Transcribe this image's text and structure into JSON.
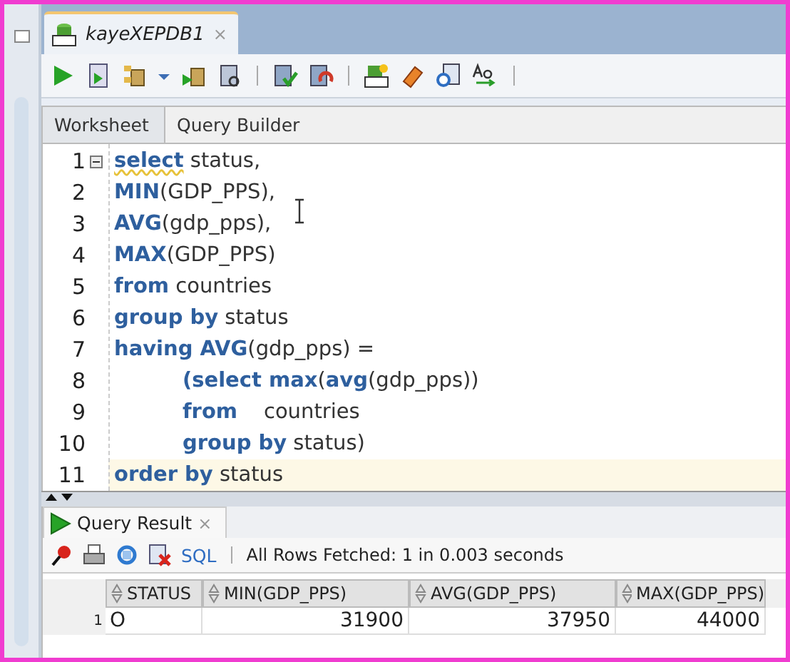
{
  "document_tab": {
    "title": "kayeXEPDB1",
    "close": "×"
  },
  "editor_tabs": [
    {
      "label": "Worksheet",
      "selected": true
    },
    {
      "label": "Query Builder",
      "selected": false
    }
  ],
  "code_lines": [
    {
      "number": "1",
      "current": false,
      "indented": false,
      "tokens": [
        {
          "text": "select",
          "kind": "flagged"
        },
        {
          "text": " status,",
          "kind": "plain"
        }
      ]
    },
    {
      "number": "2",
      "current": false,
      "indented": false,
      "tokens": [
        {
          "text": "MIN",
          "kind": "keyword"
        },
        {
          "text": "(GDP_PPS),",
          "kind": "plain"
        }
      ]
    },
    {
      "number": "3",
      "current": false,
      "indented": false,
      "tokens": [
        {
          "text": "AVG",
          "kind": "keyword"
        },
        {
          "text": "(gdp_pps),",
          "kind": "plain"
        }
      ]
    },
    {
      "number": "4",
      "current": false,
      "indented": false,
      "tokens": [
        {
          "text": "MAX",
          "kind": "keyword"
        },
        {
          "text": "(GDP_PPS)",
          "kind": "plain"
        }
      ]
    },
    {
      "number": "5",
      "current": false,
      "indented": false,
      "tokens": [
        {
          "text": "from",
          "kind": "keyword"
        },
        {
          "text": " countries",
          "kind": "plain"
        }
      ]
    },
    {
      "number": "6",
      "current": false,
      "indented": false,
      "tokens": [
        {
          "text": "group by",
          "kind": "keyword"
        },
        {
          "text": " status",
          "kind": "plain"
        }
      ]
    },
    {
      "number": "7",
      "current": false,
      "indented": false,
      "tokens": [
        {
          "text": "having AVG",
          "kind": "keyword"
        },
        {
          "text": "(gdp_pps) =",
          "kind": "plain"
        }
      ]
    },
    {
      "number": "8",
      "current": false,
      "indented": true,
      "tokens": [
        {
          "text": "(select max",
          "kind": "keyword"
        },
        {
          "text": "(",
          "kind": "plain"
        },
        {
          "text": "avg",
          "kind": "keyword"
        },
        {
          "text": "(gdp_pps))",
          "kind": "plain"
        }
      ]
    },
    {
      "number": "9",
      "current": false,
      "indented": true,
      "tokens": [
        {
          "text": "from",
          "kind": "keyword"
        },
        {
          "text": "    countries",
          "kind": "plain"
        }
      ]
    },
    {
      "number": "10",
      "current": false,
      "indented": true,
      "tokens": [
        {
          "text": "group by",
          "kind": "keyword"
        },
        {
          "text": " status)",
          "kind": "plain"
        }
      ]
    },
    {
      "number": "11",
      "current": true,
      "indented": false,
      "tokens": [
        {
          "text": "order by",
          "kind": "keyword"
        },
        {
          "text": " status",
          "kind": "plain"
        }
      ]
    }
  ],
  "result_tab": {
    "title": "Query Result",
    "close": "×"
  },
  "result_toolbar": {
    "sql_link": "SQL",
    "status": "All Rows Fetched: 1 in 0.003 seconds"
  },
  "table": {
    "columns": [
      {
        "label": "STATUS",
        "kind": "text"
      },
      {
        "label": "MIN(GDP_PPS)",
        "kind": "number"
      },
      {
        "label": "AVG(GDP_PPS)",
        "kind": "number"
      },
      {
        "label": "MAX(GDP_PPS)",
        "kind": "number"
      }
    ],
    "rows": [
      {
        "number": "1",
        "cells": [
          "O",
          "31900",
          "37950",
          "44000"
        ]
      }
    ]
  }
}
